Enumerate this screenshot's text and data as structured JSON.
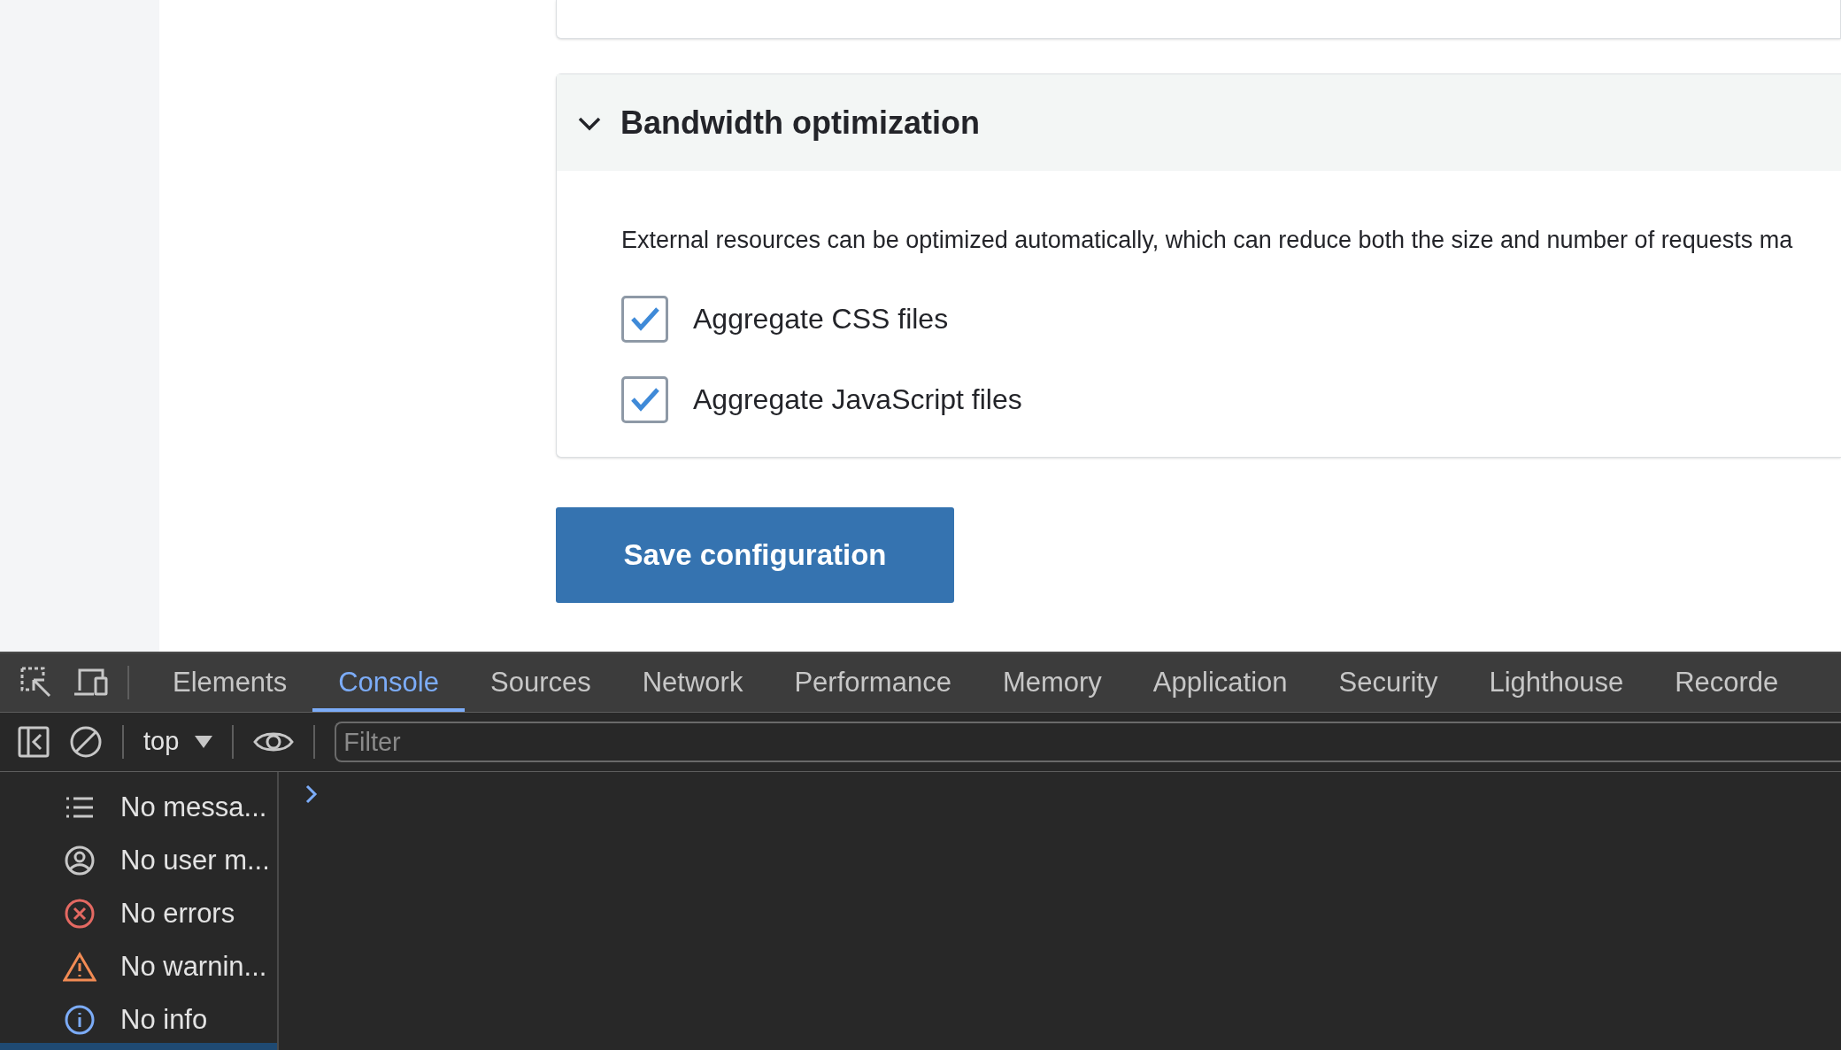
{
  "section": {
    "title": "Bandwidth optimization",
    "expanded": true,
    "description": "External resources can be optimized automatically, which can reduce both the size and number of requests ma",
    "options": [
      {
        "label": "Aggregate CSS files",
        "checked": true
      },
      {
        "label": "Aggregate JavaScript files",
        "checked": true
      }
    ]
  },
  "save_button": "Save configuration",
  "devtools": {
    "tabs": [
      {
        "label": "Elements",
        "selected": false
      },
      {
        "label": "Console",
        "selected": true
      },
      {
        "label": "Sources",
        "selected": false
      },
      {
        "label": "Network",
        "selected": false
      },
      {
        "label": "Performance",
        "selected": false
      },
      {
        "label": "Memory",
        "selected": false
      },
      {
        "label": "Application",
        "selected": false
      },
      {
        "label": "Security",
        "selected": false
      },
      {
        "label": "Lighthouse",
        "selected": false
      },
      {
        "label": "Recorde",
        "selected": false
      }
    ],
    "context": "top",
    "filter": {
      "placeholder": "Filter"
    },
    "sidebar": [
      {
        "kind": "messages",
        "label": "No messa..."
      },
      {
        "kind": "user",
        "label": "No user m..."
      },
      {
        "kind": "errors",
        "label": "No errors"
      },
      {
        "kind": "warnings",
        "label": "No warnin..."
      },
      {
        "kind": "info",
        "label": "No info"
      }
    ]
  }
}
